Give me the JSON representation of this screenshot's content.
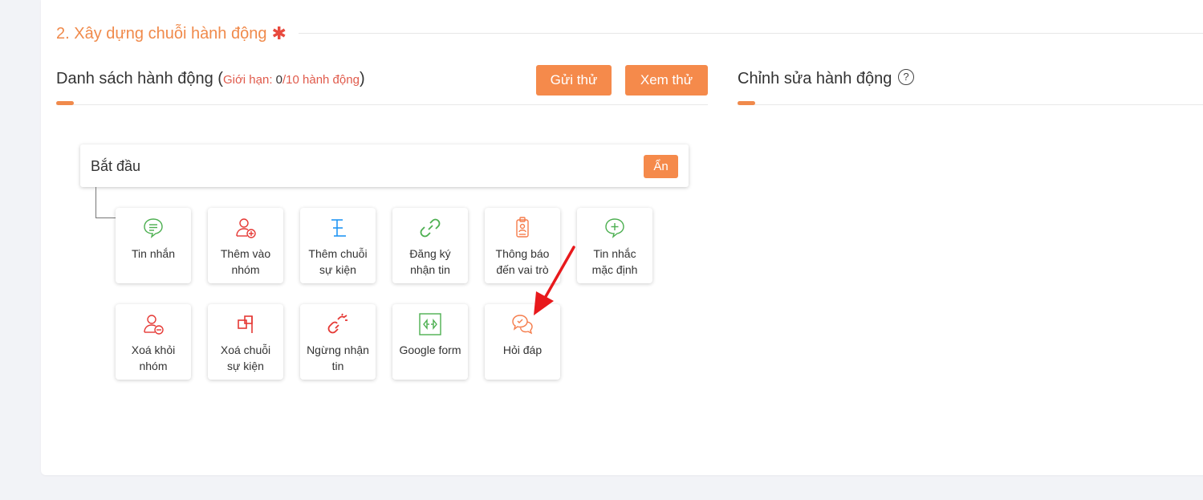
{
  "section": {
    "title": "2. Xây dựng chuỗi hành động",
    "required_mark": "✱"
  },
  "list_panel": {
    "title": "Danh sách hành động",
    "limit_open": "(",
    "limit_label": "Giới hạn: ",
    "limit_count": "0",
    "limit_total": "/10 hành động",
    "limit_close": ")",
    "send_test_label": "Gửi thử",
    "preview_label": "Xem thử"
  },
  "edit_panel": {
    "title": "Chỉnh sửa hành động",
    "help": "?"
  },
  "start": {
    "label": "Bắt đầu",
    "hide_label": "Ẩn"
  },
  "actions": [
    {
      "line1": "Tin nhắn",
      "line2": "",
      "icon": "message-icon",
      "color": "#4caf50"
    },
    {
      "line1": "Thêm vào",
      "line2": "nhóm",
      "icon": "add-user-icon",
      "color": "#e53935"
    },
    {
      "line1": "Thêm chuỗi",
      "line2": "sự kiện",
      "icon": "flow-icon",
      "color": "#2196f3"
    },
    {
      "line1": "Đăng ký",
      "line2": "nhận tin",
      "icon": "link-icon",
      "color": "#4caf50"
    },
    {
      "line1": "Thông báo",
      "line2": "đến vai trò",
      "icon": "id-badge-icon",
      "color": "#f57c4b"
    },
    {
      "line1": "Tin nhắc",
      "line2": "mặc định",
      "icon": "message-plus-icon",
      "color": "#4caf50"
    },
    {
      "line1": "Xoá khỏi",
      "line2": "nhóm",
      "icon": "remove-user-icon",
      "color": "#e53935"
    },
    {
      "line1": "Xoá chuỗi",
      "line2": "sự kiện",
      "icon": "remove-flow-icon",
      "color": "#e53935"
    },
    {
      "line1": "Ngừng nhận",
      "line2": "tin",
      "icon": "unlink-icon",
      "color": "#e53935"
    },
    {
      "line1": "Google form",
      "line2": "",
      "icon": "form-icon",
      "color": "#4caf50"
    },
    {
      "line1": "Hỏi đáp",
      "line2": "",
      "icon": "chat-icon",
      "color": "#f57c4b"
    }
  ]
}
